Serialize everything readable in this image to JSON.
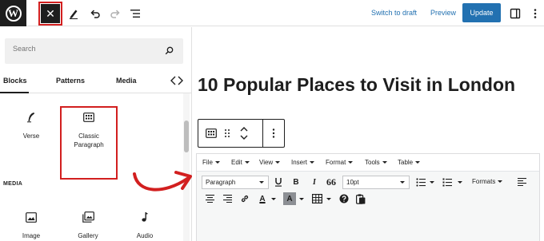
{
  "topbar": {
    "logo_letter": "W",
    "close_icon": "✕",
    "switch_to_draft": "Switch to draft",
    "preview": "Preview",
    "update": "Update"
  },
  "inserter": {
    "search_placeholder": "Search",
    "tabs": [
      "Blocks",
      "Patterns",
      "Media"
    ],
    "blocks": [
      {
        "label": "Verse",
        "icon": "verse-icon"
      },
      {
        "label": "Classic Paragraph",
        "icon": "classic-icon"
      }
    ],
    "media_heading": "MEDIA",
    "media_blocks": [
      {
        "label": "Image",
        "icon": "image-icon"
      },
      {
        "label": "Gallery",
        "icon": "gallery-icon"
      },
      {
        "label": "Audio",
        "icon": "audio-icon"
      }
    ]
  },
  "editor": {
    "post_title": "10 Popular Places to Visit in London",
    "classic": {
      "menus": [
        "File",
        "Edit",
        "View",
        "Insert",
        "Format",
        "Tools",
        "Table"
      ],
      "paragraph_select": "Paragraph",
      "fontsize_select": "10pt",
      "formats": "Formats",
      "bold": "B",
      "italic": "I",
      "quote": "66",
      "color_a": "A"
    }
  },
  "colors": {
    "accent": "#2271b1",
    "highlight": "#d21f1f",
    "dark": "#1e1e1e"
  }
}
